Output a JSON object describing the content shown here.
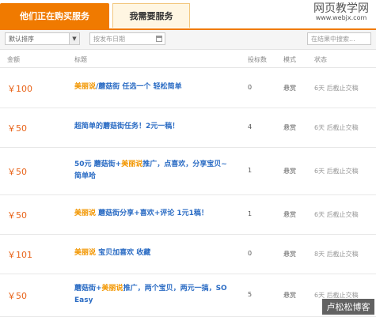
{
  "tabs": {
    "active": "他们正在购买服务",
    "inactive": "我需要服务"
  },
  "watermark_top": {
    "line1": "网页教学网",
    "line2": "www.webjx.com"
  },
  "filters": {
    "sort_value": "默认排序",
    "date_placeholder": "按发布日期",
    "search_placeholder": "在结果中搜索..."
  },
  "columns": {
    "amount": "金额",
    "title": "标题",
    "bids": "投标数",
    "mode": "模式",
    "status": "状态"
  },
  "rows": [
    {
      "amount": "￥100",
      "title_parts": [
        [
          "美丽说",
          "brand"
        ],
        [
          "/蘑菇街 任选一个 轻松简单",
          ""
        ]
      ],
      "bids": "0",
      "mode": "悬赏",
      "status": "6天 后截止交稿"
    },
    {
      "amount": "￥50",
      "title_parts": [
        [
          "超简单的蘑菇街任务！2元一稿！",
          ""
        ]
      ],
      "bids": "4",
      "mode": "悬赏",
      "status": "6天 后截止交稿"
    },
    {
      "amount": "￥50",
      "title_parts": [
        [
          "50元 蘑菇街+",
          ""
        ],
        [
          "美丽说",
          "brand"
        ],
        [
          "推广，点喜欢，分享宝贝~简单哈",
          ""
        ]
      ],
      "bids": "1",
      "mode": "悬赏",
      "status": "6天 后截止交稿"
    },
    {
      "amount": "￥50",
      "title_parts": [
        [
          "美丽说",
          "brand"
        ],
        [
          " 蘑菇街分享+喜欢+评论 1元1稿！",
          ""
        ]
      ],
      "bids": "1",
      "mode": "悬赏",
      "status": "6天 后截止交稿"
    },
    {
      "amount": "￥101",
      "title_parts": [
        [
          "美丽说",
          "brand"
        ],
        [
          " 宝贝加喜欢 收藏",
          ""
        ]
      ],
      "bids": "0",
      "mode": "悬赏",
      "status": "8天 后截止交稿"
    },
    {
      "amount": "￥50",
      "title_parts": [
        [
          "蘑菇街+",
          ""
        ],
        [
          "美丽说",
          "brand"
        ],
        [
          "推广，两个宝贝，两元一搞，SO Easy",
          ""
        ]
      ],
      "bids": "5",
      "mode": "悬赏",
      "status": "6天 后截止交稿"
    }
  ],
  "watermark_bottom": "卢松松博客"
}
